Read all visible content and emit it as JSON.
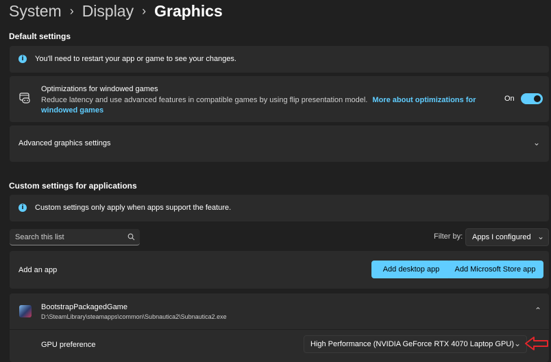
{
  "breadcrumb": {
    "item1": "System",
    "item2": "Display",
    "item3": "Graphics"
  },
  "default_settings": {
    "title": "Default settings",
    "restart_notice": "You'll need to restart your app or game to see your changes.",
    "optimizations": {
      "title": "Optimizations for windowed games",
      "description": "Reduce latency and use advanced features in compatible games by using flip presentation model.",
      "link_line1": "More about optimizations for",
      "link_line2": "windowed games",
      "toggle_label": "On",
      "toggle_on": true
    },
    "advanced": "Advanced graphics settings"
  },
  "custom_settings": {
    "title": "Custom settings for applications",
    "notice": "Custom settings only apply when apps support the feature.",
    "search_placeholder": "Search this list",
    "filter_label": "Filter by:",
    "filter_value": "Apps I configured",
    "add_app_label": "Add an app",
    "add_desktop_button": "Add desktop app",
    "add_store_button": "Add Microsoft Store app",
    "app": {
      "name": "BootstrapPackagedGame",
      "path": "D:\\SteamLibrary\\steamapps\\common\\Subnautica2\\Subnautica2.exe",
      "gpu_label": "GPU preference",
      "gpu_value": "High Performance (NVIDIA GeForce RTX 4070 Laptop GPU)"
    }
  },
  "colors": {
    "accent": "#60cdff",
    "background": "#202020",
    "card": "#2b2b2b",
    "annotation_arrow": "#e3262b"
  },
  "icons": [
    "info-icon",
    "gamepad-window-icon",
    "chevron-down-icon",
    "chevron-up-icon",
    "search-icon",
    "red-arrow-annotation"
  ]
}
